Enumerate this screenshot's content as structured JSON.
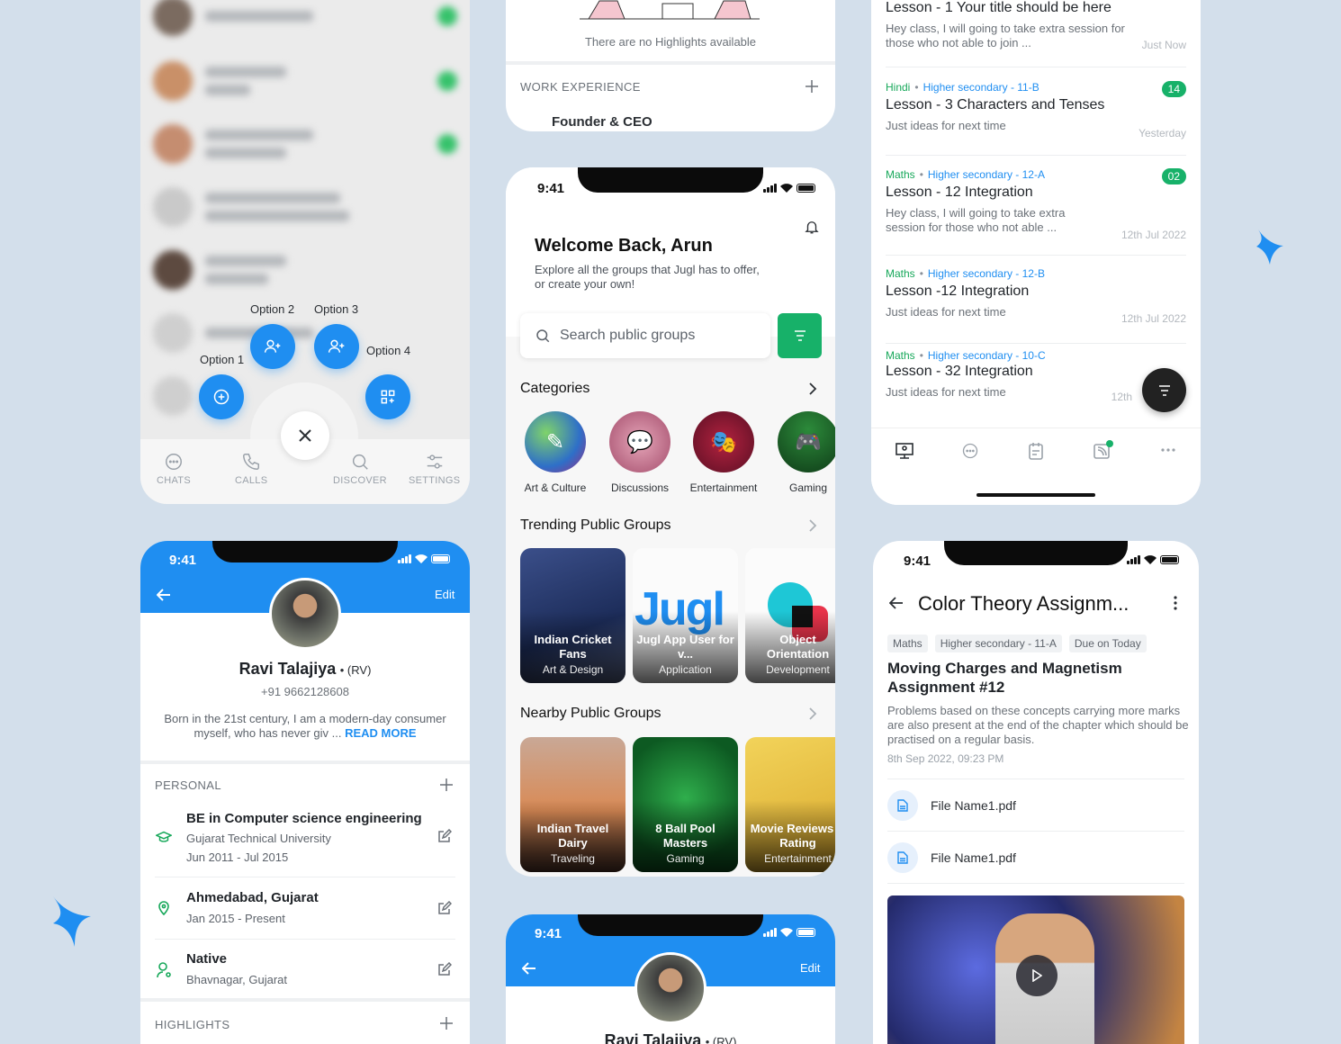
{
  "status_time": "9:41",
  "chats_screen": {
    "options": [
      "Option 1",
      "Option 2",
      "Option 3",
      "Option 4"
    ],
    "tabs": [
      "CHATS",
      "CALLS",
      "DISCOVER",
      "SETTINGS"
    ]
  },
  "profile_top": {
    "highlights_empty": "There are no Highlights available",
    "work_experience_label": "WORK EXPERIENCE",
    "work_role": "Founder & CEO"
  },
  "home": {
    "welcome": "Welcome Back, Arun",
    "subtitle": "Explore all the groups that Jugl has to offer, or create your own!",
    "search_placeholder": "Search public groups",
    "categories_title": "Categories",
    "categories": [
      "Art & Culture",
      "Discussions",
      "Entertainment",
      "Gaming"
    ],
    "trending_title": "Trending Public Groups",
    "trending": [
      {
        "name": "Indian Cricket Fans",
        "sub": "Art & Design"
      },
      {
        "name": "Jugl App User for v...",
        "sub": "Application"
      },
      {
        "name": "Object Orientation",
        "sub": "Development"
      }
    ],
    "jugl_logo": "Jugl",
    "nearby_title": "Nearby Public Groups",
    "nearby": [
      {
        "name": "Indian Travel Dairy",
        "sub": "Traveling"
      },
      {
        "name": "8 Ball Pool Masters",
        "sub": "Gaming"
      },
      {
        "name": "Movie Reviews & Rating",
        "sub": "Entertainment"
      }
    ]
  },
  "lessons": [
    {
      "title": "Lesson - 1 Your title should be here",
      "body": "Hey class, I will going to take extra session for those who not able to join ...",
      "time": "Just Now"
    },
    {
      "subject": "Hindi",
      "grade": "Higher secondary - 11-B",
      "badge": "14",
      "title": "Lesson - 3 Characters and Tenses",
      "body": "Just ideas for next time",
      "time": "Yesterday"
    },
    {
      "subject": "Maths",
      "grade": "Higher secondary - 12-A",
      "badge": "02",
      "title": "Lesson - 12 Integration",
      "body": "Hey class, I will going to take extra session for those who not able ...",
      "time": "12th Jul 2022"
    },
    {
      "subject": "Maths",
      "grade": "Higher secondary - 12-B",
      "title": "Lesson -12 Integration",
      "body": "Just ideas for next time",
      "time": "12th Jul 2022"
    },
    {
      "subject": "Maths",
      "grade": "Higher secondary - 10-C",
      "title": "Lesson - 32 Integration",
      "body": "Just ideas for next time",
      "time": "12th"
    }
  ],
  "profile": {
    "edit": "Edit",
    "name": "Ravi Talajiya",
    "nick": "• (RV)",
    "phone": "+91 9662128608",
    "bio": "Born in the 21st century, I am a modern-day consumer myself, who has never giv ...",
    "read_more": "READ MORE",
    "personal_label": "PERSONAL",
    "education": {
      "title": "BE in Computer science engineering",
      "school": "Gujarat Technical University",
      "dates": "Jun 2011 - Jul 2015"
    },
    "location": {
      "title": "Ahmedabad, Gujarat",
      "dates": "Jan 2015 - Present"
    },
    "native": {
      "title": "Native",
      "place": "Bhavnagar, Gujarat"
    },
    "highlights_label": "HIGHLIGHTS"
  },
  "profile_bottom": {
    "edit": "Edit",
    "name": "Ravi Talajiya",
    "nick": "• (RV)"
  },
  "assignment": {
    "header": "Color Theory Assignm...",
    "chips": [
      "Maths",
      "Higher secondary - 11-A",
      "Due on Today"
    ],
    "title": "Moving Charges and Magnetism Assignment #12",
    "body": "Problems based on these concepts carrying more marks are also present at the end of the chapter which should be practised on a regular basis.",
    "date": "8th Sep 2022, 09:23 PM",
    "files": [
      "File Name1.pdf",
      "File Name1.pdf"
    ]
  },
  "colors": {
    "accent": "#1f8ef1",
    "green": "#17a85a",
    "badge": "#17b169",
    "background": "#d3dfeb"
  }
}
